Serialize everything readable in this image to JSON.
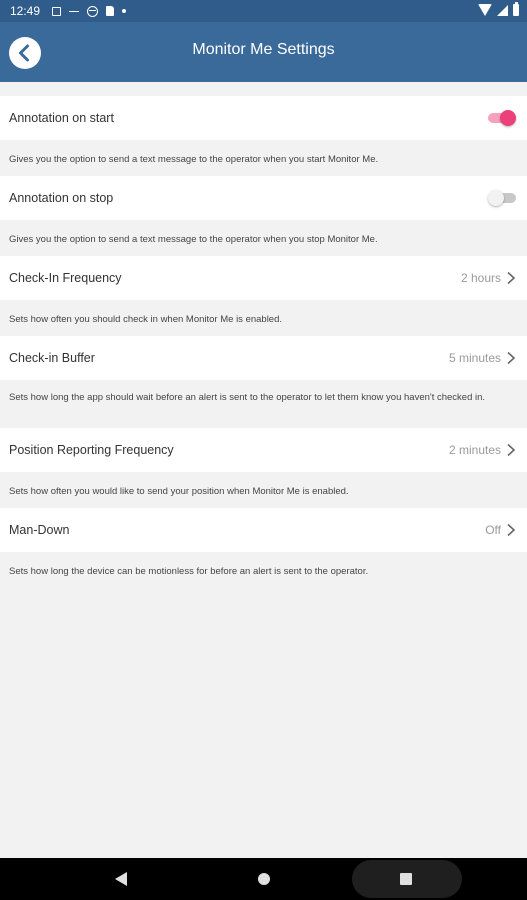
{
  "status_bar": {
    "time": "12:49",
    "icons": [
      "notification-a-icon",
      "minus-icon",
      "do-not-disturb-icon",
      "sd-card-icon",
      "dot-icon",
      "wifi-icon",
      "signal-icon",
      "battery-icon"
    ]
  },
  "app_bar": {
    "title": "Monitor Me Settings",
    "back_icon": "chevron-left-icon",
    "color": "#3a6a9a"
  },
  "settings": {
    "annotation_start": {
      "label": "Annotation on start",
      "enabled": true,
      "description": "Gives you the option to send a text message to the operator when you start Monitor Me."
    },
    "annotation_stop": {
      "label": "Annotation on stop",
      "enabled": false,
      "description": "Gives you the option to send a text message to the operator when you stop Monitor Me."
    },
    "checkin_frequency": {
      "label": "Check-In Frequency",
      "value": "2 hours",
      "description": "Sets how often you should check in when Monitor Me is enabled."
    },
    "checkin_buffer": {
      "label": "Check-in Buffer",
      "value": "5 minutes",
      "description": "Sets how long the app should wait before an alert is sent to the operator to let them know you haven't checked in."
    },
    "position_frequency": {
      "label": "Position Reporting Frequency",
      "value": "2 minutes",
      "description": "Sets how often you would like to send your position when Monitor Me is enabled."
    },
    "man_down": {
      "label": "Man-Down",
      "value": "Off",
      "description": "Sets how long the device can be motionless for before an alert is sent to the operator."
    }
  },
  "colors": {
    "toggle_on": "#ec407a",
    "toggle_off": "#c8c8c8",
    "background": "#f2f2f2"
  },
  "nav_bar": {
    "icons": [
      "back-triangle-icon",
      "home-circle-icon",
      "recents-square-icon"
    ]
  }
}
